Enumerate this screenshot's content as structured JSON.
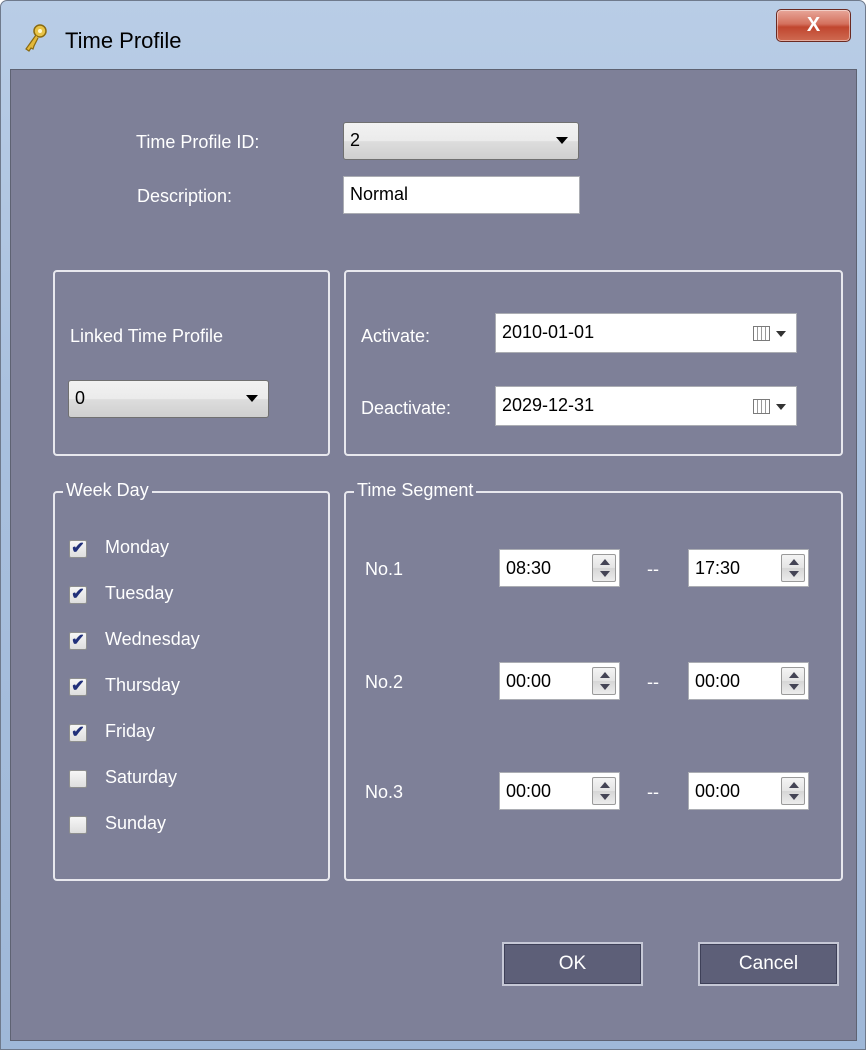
{
  "window": {
    "title": "Time Profile",
    "close_label": "X"
  },
  "header": {
    "profile_id_label": "Time Profile ID:",
    "profile_id_value": "2",
    "description_label": "Description:",
    "description_value": "Normal"
  },
  "linked": {
    "label": "Linked Time Profile",
    "value": "0"
  },
  "dates": {
    "activate_label": "Activate:",
    "activate_value": "2010-01-01",
    "deactivate_label": "Deactivate:",
    "deactivate_value": "2029-12-31"
  },
  "week": {
    "title": "Week Day",
    "days": [
      {
        "label": "Monday",
        "checked": true
      },
      {
        "label": "Tuesday",
        "checked": true
      },
      {
        "label": "Wednesday",
        "checked": true
      },
      {
        "label": "Thursday",
        "checked": true
      },
      {
        "label": "Friday",
        "checked": true
      },
      {
        "label": "Saturday",
        "checked": false
      },
      {
        "label": "Sunday",
        "checked": false
      }
    ]
  },
  "segments": {
    "title": "Time Segment",
    "separator": "--",
    "items": [
      {
        "label": "No.1",
        "start": "08:30",
        "end": "17:30"
      },
      {
        "label": "No.2",
        "start": "00:00",
        "end": "00:00"
      },
      {
        "label": "No.3",
        "start": "00:00",
        "end": "00:00"
      }
    ]
  },
  "buttons": {
    "ok": "OK",
    "cancel": "Cancel"
  },
  "colors": {
    "client_bg": "#7e8098",
    "button_bg": "#5d5f78",
    "check_color": "#21307a"
  }
}
